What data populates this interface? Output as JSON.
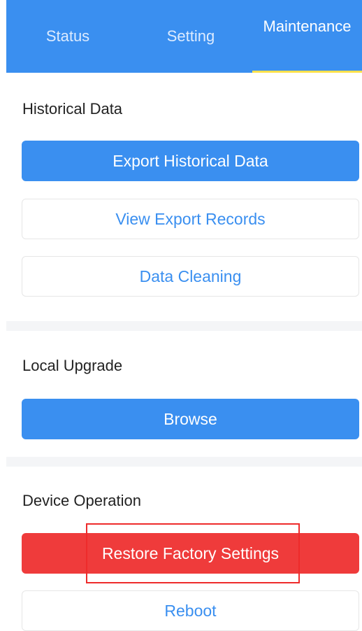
{
  "tabs": {
    "status": "Status",
    "setting": "Setting",
    "maintenance": "Maintenance"
  },
  "historical_data": {
    "title": "Historical Data",
    "export_label": "Export Historical Data",
    "view_records_label": "View Export Records",
    "cleaning_label": "Data Cleaning"
  },
  "local_upgrade": {
    "title": "Local Upgrade",
    "browse_label": "Browse"
  },
  "device_operation": {
    "title": "Device Operation",
    "restore_label": "Restore Factory Settings",
    "reboot_label": "Reboot"
  },
  "colors": {
    "primary": "#3a8ff0",
    "danger": "#ef3b3b",
    "active_tab_indicator": "#ffe14d",
    "highlight_box": "#ee2b2b"
  }
}
